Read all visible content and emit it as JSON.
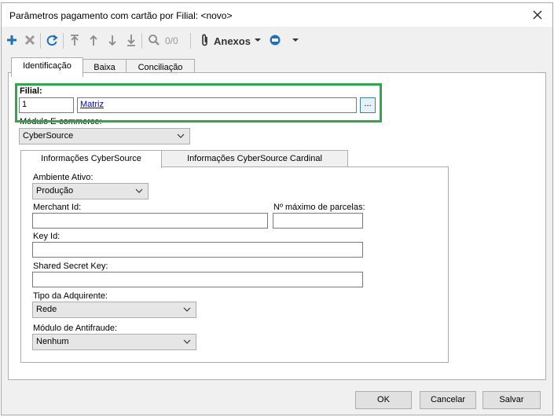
{
  "window": {
    "title": "Parâmetros pagamento com cartão por Filial: <novo>"
  },
  "toolbar": {
    "page_counter": "0/0",
    "anexos_label": "Anexos",
    "icons": [
      "add-icon",
      "delete-icon",
      "refresh-icon",
      "first-record-icon",
      "previous-record-icon",
      "next-record-icon",
      "last-record-icon",
      "search-icon",
      "attachment-icon",
      "dropdown-arrow-icon",
      "disk-icon",
      "dropdown-arrow-icon"
    ]
  },
  "tabs": [
    "Identificação",
    "Baixa",
    "Conciliação"
  ],
  "filial": {
    "label": "Filial:",
    "code": "1",
    "name": "Matriz",
    "browse_label": "..."
  },
  "modulo_ecommerce": {
    "label": "Módulo E-commerce:",
    "value": "CyberSource"
  },
  "inner_tabs": [
    "Informações CyberSource",
    "Informações CyberSource Cardinal"
  ],
  "form": {
    "ambiente_label": "Ambiente Ativo:",
    "ambiente_value": "Produção",
    "merchant_label": "Merchant Id:",
    "merchant_value": "",
    "parcelas_label": "Nº máximo de parcelas:",
    "parcelas_value": "",
    "keyid_label": "Key Id:",
    "keyid_value": "",
    "secret_label": "Shared Secret Key:",
    "secret_value": "",
    "adquirente_label": "Tipo da Adquirente:",
    "adquirente_value": "Rede",
    "antifraude_label": "Módulo de Antifraude:",
    "antifraude_value": "Nenhum"
  },
  "buttons": {
    "ok": "OK",
    "cancel": "Cancelar",
    "save": "Salvar"
  },
  "colors": {
    "accent_blue": "#1f6fbf",
    "highlight_green": "#2da84a"
  }
}
